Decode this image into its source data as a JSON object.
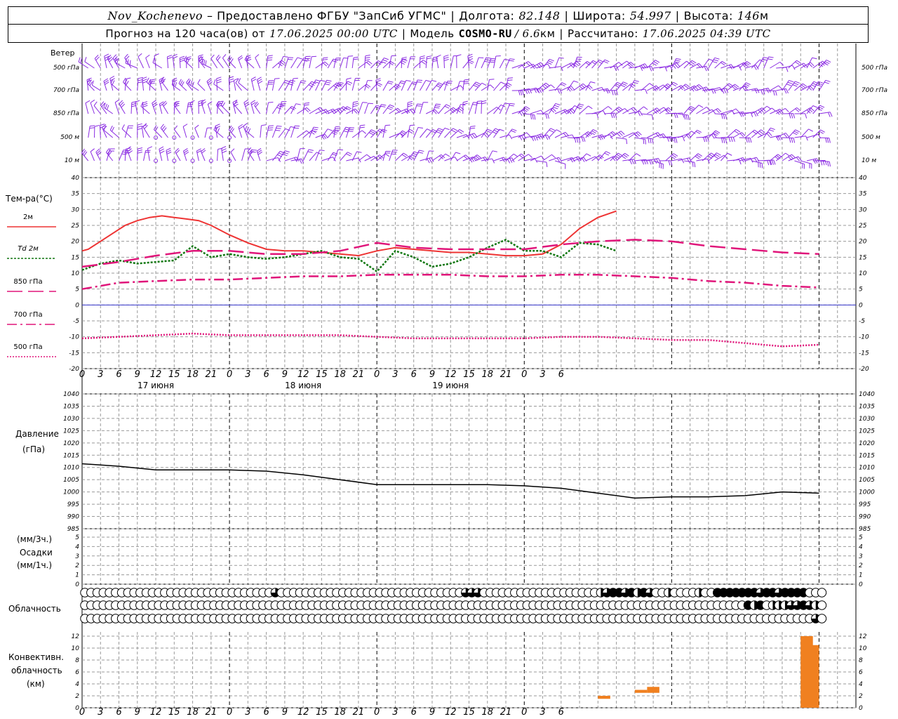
{
  "header": {
    "station": "Nov_Kochenevo",
    "provider": "– Предоставлено ФГБУ \"ЗапСиб УГМС\"",
    "lon_label": "Долгота:",
    "lon_value": "82.148",
    "lat_label": "Широта:",
    "lat_value": "54.997",
    "alt_label": "Высота:",
    "alt_value": "146",
    "alt_unit": "м",
    "forecast_label": "Прогноз на 120 часа(ов) от",
    "forecast_time": "17.06.2025 00:00 UTC",
    "model_label": "Модель",
    "model_name": "COSMO-RU",
    "model_res": "/ 6.6",
    "model_res_unit": "км",
    "calc_label": "Рассчитано:",
    "calc_time": "17.06.2025 04:39 UTC"
  },
  "wind_panel": {
    "title": "Ветер",
    "levels": [
      "500 гПа",
      "700 гПа",
      "850 гПа",
      "500 м",
      "10 м"
    ]
  },
  "temp_panel": {
    "title": "Тем-ра(°C)",
    "legend": [
      {
        "label": "2м",
        "color": "#ee3333",
        "dash": "solid"
      },
      {
        "label": "Td 2м",
        "color": "#117711",
        "dash": "dotted"
      },
      {
        "label": "850 гПа",
        "color": "#e0157a",
        "dash": "long-dash"
      },
      {
        "label": "700 гПа",
        "color": "#e0157a",
        "dash": "dash-dot"
      },
      {
        "label": "500 гПа",
        "color": "#e0157a",
        "dash": "dense-dot"
      }
    ]
  },
  "pressure_panel": {
    "title_line1": "Давление",
    "title_line2": "(гПа)"
  },
  "precip_panel": {
    "line1": "(мм/3ч.)",
    "line2": "Осадки",
    "line3": "(мм/1ч.)"
  },
  "cloud_panel": {
    "title": "Облачность"
  },
  "conv_panel": {
    "line1": "Конвективн.",
    "line2": "облачность",
    "line3": "(км)"
  },
  "x_axis": {
    "hour_ticks": [
      "0",
      "3",
      "6",
      "9",
      "12",
      "15",
      "18",
      "21",
      "0",
      "3",
      "6",
      "9",
      "12",
      "15",
      "18",
      "21",
      "0",
      "3",
      "6",
      "9",
      "12",
      "15",
      "18",
      "21",
      "0",
      "3",
      "6"
    ],
    "days": [
      "17 июня",
      "18 июня",
      "19 июня"
    ]
  },
  "chart_data": [
    {
      "type": "line",
      "title": "Тем-ра(°C)",
      "x_unit": "hours since 17.06.2025 00:00 UTC",
      "ylim": [
        -20,
        40
      ],
      "yticks": [
        -20,
        -15,
        -10,
        -5,
        0,
        5,
        10,
        15,
        20,
        25,
        30,
        35,
        40
      ],
      "zero_line": 0,
      "series": [
        {
          "name": "2м",
          "color": "#ee3333",
          "style": "solid",
          "x": [
            0,
            1,
            3,
            5,
            7,
            9,
            11,
            13,
            15,
            17,
            19,
            21,
            24,
            27,
            30,
            33,
            36,
            39,
            42,
            45,
            46,
            48,
            51,
            54,
            57,
            60,
            63,
            66,
            69,
            72,
            75,
            78,
            81,
            84,
            87
          ],
          "y": [
            17,
            17.5,
            20,
            22.5,
            25,
            26.5,
            27.5,
            28,
            27.5,
            27,
            26.5,
            25,
            22,
            19.5,
            17.5,
            17,
            17,
            16.5,
            16,
            15.5,
            16,
            17,
            18,
            17.5,
            17,
            16.5,
            16.5,
            16,
            15.5,
            15.5,
            16,
            19,
            24,
            27.5,
            29.5
          ]
        },
        {
          "name": "Td 2м",
          "color": "#117711",
          "style": "dotted",
          "x": [
            0,
            3,
            6,
            9,
            12,
            15,
            18,
            21,
            24,
            27,
            30,
            33,
            36,
            39,
            42,
            45,
            48,
            51,
            54,
            57,
            60,
            63,
            66,
            69,
            72,
            75,
            78,
            81,
            84,
            87
          ],
          "y": [
            11,
            13,
            14,
            13,
            13.5,
            14,
            18.5,
            15,
            16,
            15,
            14.5,
            15,
            16,
            17,
            15,
            14.5,
            10.5,
            17,
            15,
            12,
            13,
            15,
            18,
            20.5,
            17,
            17,
            15,
            19.5,
            19,
            17
          ]
        },
        {
          "name": "850 гПа",
          "color": "#e0157a",
          "style": "long-dash",
          "x": [
            0,
            6,
            12,
            18,
            24,
            30,
            36,
            42,
            48,
            54,
            60,
            66,
            72,
            78,
            84,
            90,
            96,
            102,
            108,
            114,
            120
          ],
          "y": [
            12,
            13.5,
            15.5,
            17,
            17,
            16,
            16,
            17,
            19.5,
            18,
            17.5,
            17.5,
            17.5,
            19,
            20,
            20.5,
            20,
            18.5,
            17.5,
            16.5,
            16
          ]
        },
        {
          "name": "700 гПа",
          "color": "#e0157a",
          "style": "dash-dot",
          "x": [
            0,
            6,
            12,
            18,
            24,
            30,
            36,
            42,
            48,
            54,
            60,
            66,
            72,
            78,
            84,
            90,
            96,
            102,
            108,
            114,
            120
          ],
          "y": [
            5,
            7,
            7.5,
            8,
            8,
            8.5,
            9,
            9,
            9.5,
            9.5,
            9.5,
            9,
            9,
            9.5,
            9.5,
            9,
            8.5,
            7.5,
            7,
            6,
            5.5
          ]
        },
        {
          "name": "500 гПа",
          "color": "#e0157a",
          "style": "dense-dot",
          "x": [
            0,
            6,
            12,
            18,
            24,
            30,
            36,
            42,
            48,
            54,
            60,
            66,
            72,
            78,
            84,
            90,
            96,
            102,
            108,
            114,
            120
          ],
          "y": [
            -10.5,
            -10,
            -9.5,
            -9,
            -9.5,
            -9.5,
            -9.5,
            -9.5,
            -10,
            -10.5,
            -10.5,
            -10.5,
            -10.5,
            -10,
            -10,
            -10.5,
            -11,
            -11,
            -12,
            -13,
            -12.5
          ]
        }
      ]
    },
    {
      "type": "line",
      "title": "Давление (гПа)",
      "ylim": [
        985,
        1040
      ],
      "yticks": [
        985,
        990,
        995,
        1000,
        1005,
        1010,
        1015,
        1020,
        1025,
        1030,
        1035,
        1040
      ],
      "series": [
        {
          "name": "Давление",
          "color": "#000000",
          "x": [
            0,
            6,
            12,
            18,
            24,
            30,
            36,
            42,
            48,
            54,
            60,
            66,
            72,
            78,
            84,
            90,
            96,
            102,
            108,
            114,
            120
          ],
          "y": [
            1011.5,
            1010.5,
            1009,
            1009,
            1009,
            1008.5,
            1007,
            1005,
            1003,
            1003,
            1003,
            1003,
            1002.5,
            1001.5,
            999.5,
            997.5,
            998,
            998,
            998.5,
            1000,
            999.5
          ]
        }
      ]
    },
    {
      "type": "bar",
      "title": "Осадки",
      "ylim": [
        0,
        5
      ],
      "yticks": [
        0,
        1,
        2,
        3,
        4,
        5
      ],
      "values": []
    },
    {
      "type": "table",
      "title": "Облачность",
      "rows": 3,
      "cols_every_hours": 1
    },
    {
      "type": "bar",
      "title": "Конвективн. облачность (км)",
      "ylim": [
        0,
        12
      ],
      "yticks": [
        0,
        2,
        4,
        6,
        8,
        10,
        12
      ],
      "bars": [
        {
          "x": [
            84,
            86
          ],
          "bottom": 1.5,
          "top": 2
        },
        {
          "x": [
            90,
            92
          ],
          "bottom": 2.5,
          "top": 3
        },
        {
          "x": [
            92,
            94
          ],
          "bottom": 2.5,
          "top": 3.5
        },
        {
          "x": [
            117,
            119
          ],
          "bottom": 0,
          "top": 12
        },
        {
          "x": [
            118,
            120
          ],
          "bottom": 0,
          "top": 10.5
        }
      ]
    }
  ],
  "colors": {
    "grid": "#999999",
    "wind": "#8a2be2",
    "conv": "#f08020",
    "zero": "#3333cc"
  }
}
